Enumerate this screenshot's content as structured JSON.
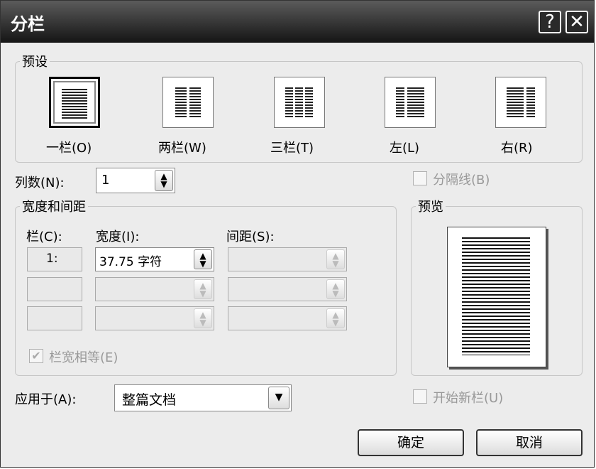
{
  "window": {
    "title": "分栏",
    "help_glyph": "?",
    "close_glyph": "✕"
  },
  "presets": {
    "legend": "预设",
    "items": [
      {
        "label": "一栏(O)",
        "selected": true
      },
      {
        "label": "两栏(W)",
        "selected": false
      },
      {
        "label": "三栏(T)",
        "selected": false
      },
      {
        "label": "左(L)",
        "selected": false
      },
      {
        "label": "右(R)",
        "selected": false
      }
    ]
  },
  "columns": {
    "label": "列数(N):",
    "value": "1"
  },
  "separator": {
    "label": "分隔线(B)",
    "checked": false
  },
  "width_spacing": {
    "legend": "宽度和间距",
    "col_header": "栏(C):",
    "width_header": "宽度(I):",
    "spacing_header": "间距(S):",
    "rows": [
      {
        "col": "1:",
        "width": "37.75 字符",
        "spacing": ""
      },
      {
        "col": "",
        "width": "",
        "spacing": ""
      },
      {
        "col": "",
        "width": "",
        "spacing": ""
      }
    ],
    "equal_label": "栏宽相等(E)",
    "equal_checked": true
  },
  "preview": {
    "legend": "预览"
  },
  "apply_to": {
    "label": "应用于(A):",
    "value": "整篇文档"
  },
  "new_column": {
    "label": "开始新栏(U)",
    "checked": false
  },
  "buttons": {
    "ok": "确定",
    "cancel": "取消"
  },
  "icons": {
    "spin": "spin-arrows-icon",
    "dropdown": "chevron-down-icon",
    "check": "checkmark-icon"
  }
}
